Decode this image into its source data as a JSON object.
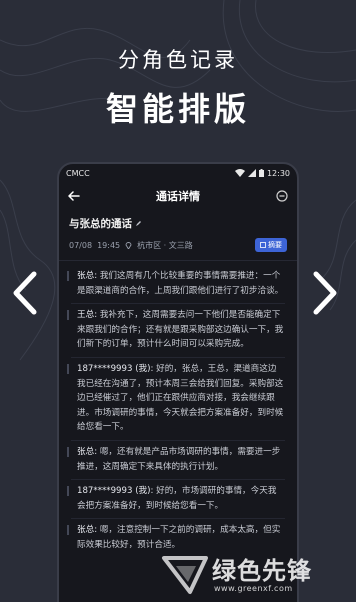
{
  "promo": {
    "subtitle": "分角色记录",
    "title": "智能排版"
  },
  "statusbar": {
    "carrier": "CMCC",
    "time": "12:30"
  },
  "appbar": {
    "title": "通话详情"
  },
  "call": {
    "title": "与张总的通话",
    "date": "07/08",
    "time": "19:45",
    "location": "杭市区 · 文三路",
    "summary_label": "摘要"
  },
  "transcript": [
    {
      "speaker": "张总:",
      "text": " 我们这周有几个比较重要的事情需要推进：一个是跟渠道商的合作，上周我们跟他们进行了初步洽谈。"
    },
    {
      "speaker": "王总:",
      "text": " 我补充下，这周需要去问一下他们是否能确定下来跟我们的合作；还有就是跟采购部这边确认一下，我们新下的订单，预计什么时间可以采购完成。"
    },
    {
      "speaker": "187****9993 (我):",
      "text": " 好的，张总，王总，渠道商这边我已经在沟通了，预计本周三会给我们回复。采购部这边已经催过了，他们正在跟供应商对接，我会继续跟进。市场调研的事情，今天就会把方案准备好，到时候给您看一下。"
    },
    {
      "speaker": "张总:",
      "text": " 嗯，还有就是产品市场调研的事情，需要进一步推进，这周确定下来具体的执行计划。"
    },
    {
      "speaker": "187****9993 (我):",
      "text": " 好的，市场调研的事情，今天我会把方案准备好，到时候给您看一下。"
    },
    {
      "speaker": "张总:",
      "text": " 嗯，注意控制一下之前的调研，成本太高，但实际效果比较好，预计合适。"
    }
  ],
  "watermark": {
    "text": "绿色先锋",
    "url": "www.greenxf.com"
  },
  "colors": {
    "background": "#2a2d38",
    "phone": "#16171d",
    "accent": "#3d64d6"
  }
}
